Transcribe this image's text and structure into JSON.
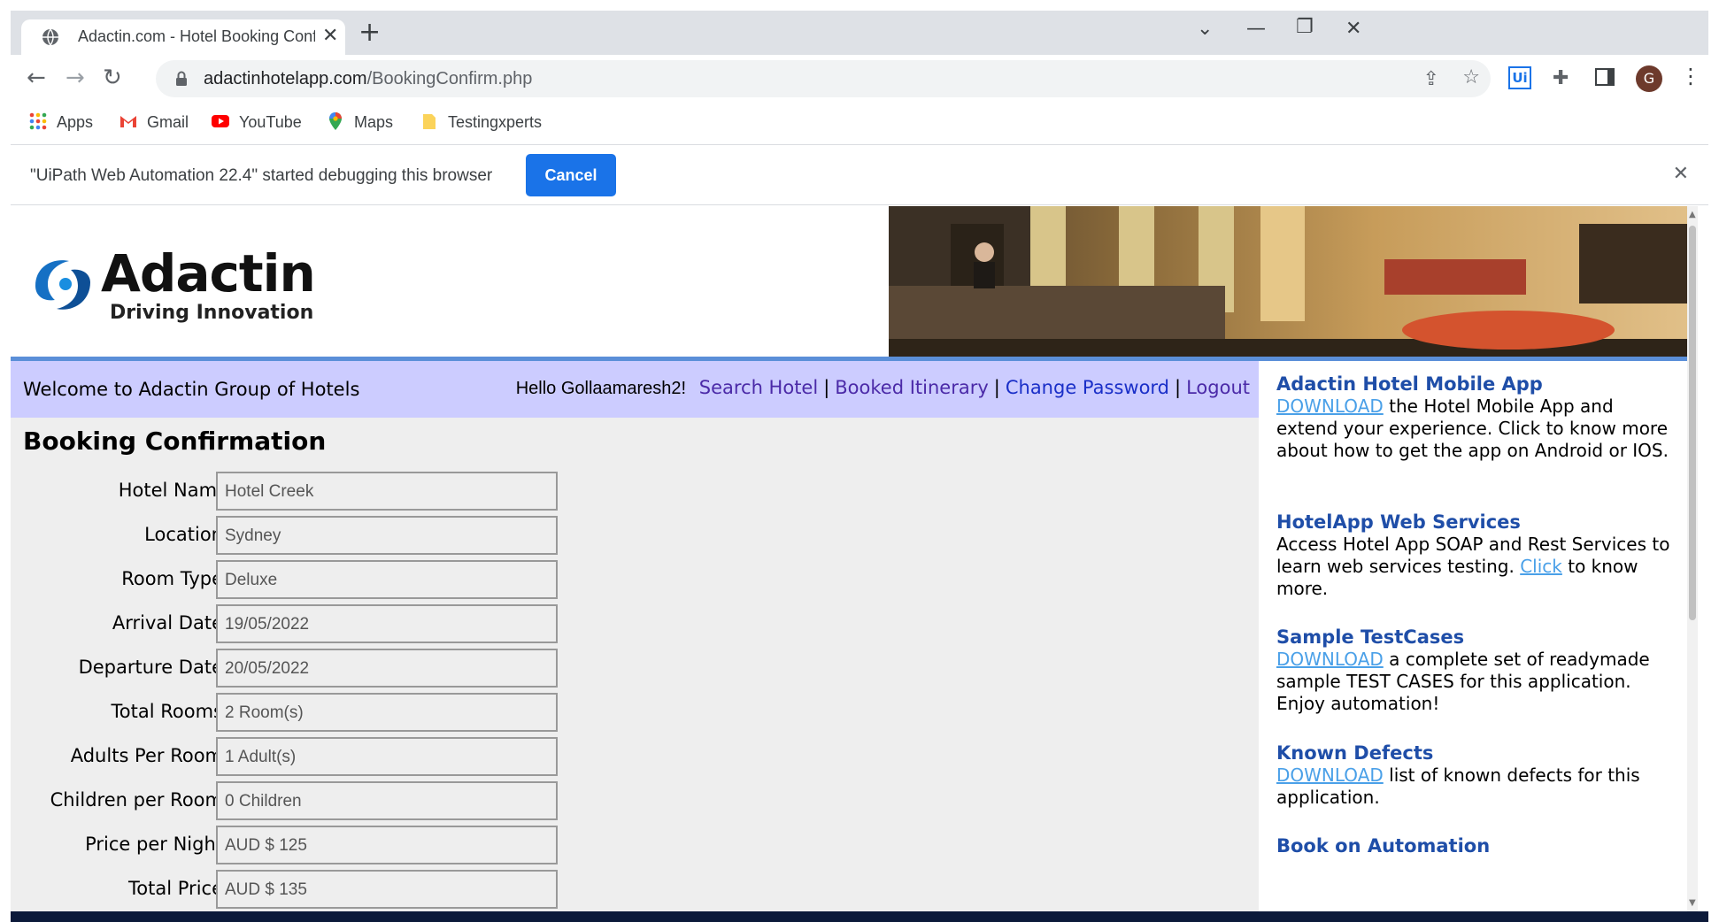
{
  "browser": {
    "tab_title": "Adactin.com - Hotel Booking Confirmation",
    "url_domain": "adactinhotelapp.com",
    "url_path": "/BookingConfirm.php",
    "bookmarks": [
      "Apps",
      "Gmail",
      "YouTube",
      "Maps",
      "Testingxperts"
    ],
    "profile_initial": "G",
    "infobar_message": "\"UiPath Web Automation 22.4\" started debugging this browser",
    "infobar_cancel": "Cancel"
  },
  "header": {
    "logo_name": "Adactin",
    "logo_tagline": "Driving Innovation"
  },
  "welcome_bar": {
    "welcome": "Welcome to Adactin Group of Hotels",
    "hello": "Hello Gollaamaresh2!",
    "links": [
      "Search Hotel",
      "Booked Itinerary",
      "Change Password",
      "Logout"
    ]
  },
  "booking": {
    "title": "Booking Confirmation",
    "fields": [
      {
        "label": "Hotel Name",
        "value": "Hotel Creek"
      },
      {
        "label": "Location",
        "value": "Sydney"
      },
      {
        "label": "Room Type",
        "value": "Deluxe"
      },
      {
        "label": "Arrival Date",
        "value": "19/05/2022"
      },
      {
        "label": "Departure Date",
        "value": "20/05/2022"
      },
      {
        "label": "Total Rooms",
        "value": "2 Room(s)"
      },
      {
        "label": "Adults Per Room",
        "value": "1 Adult(s)"
      },
      {
        "label": "Children per Room",
        "value": "0 Children"
      },
      {
        "label": "Price per Night",
        "value": "AUD $ 125"
      },
      {
        "label": "Total Price",
        "value": "AUD $ 135"
      }
    ]
  },
  "sidebar": {
    "mobile_app": {
      "heading": "Adactin Hotel Mobile App",
      "link": "DOWNLOAD",
      "text": " the Hotel Mobile App and extend your experience. Click to know more about how to get the app on Android or IOS."
    },
    "web_services": {
      "heading": "HotelApp Web Services",
      "text_before": "Access Hotel App SOAP and Rest Services to learn web services testing. ",
      "link": "Click",
      "text_after": " to know more."
    },
    "test_cases": {
      "heading": "Sample TestCases",
      "link": "DOWNLOAD",
      "text": " a complete set of readymade sample TEST CASES for this application. Enjoy automation!"
    },
    "known_defects": {
      "heading": "Known Defects",
      "link": "DOWNLOAD",
      "text": " list of known defects for this application."
    },
    "book": {
      "heading": "Book on Automation"
    }
  }
}
